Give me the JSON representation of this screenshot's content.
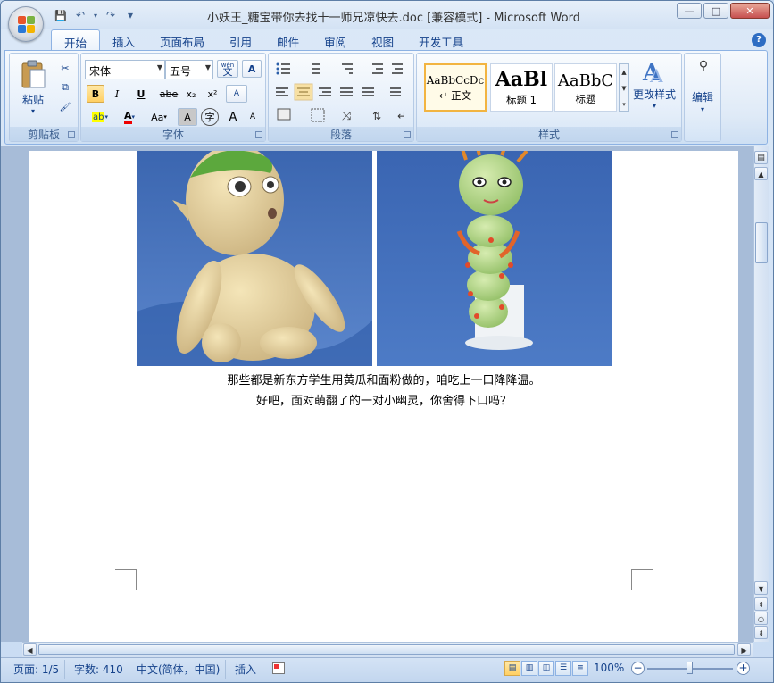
{
  "window": {
    "title": "小妖王_糖宝带你去找十一师兄凉快去.doc [兼容模式] - Microsoft Word",
    "minimize": "—",
    "maximize": "□",
    "close": "✕"
  },
  "quick_access": {
    "save": "💾",
    "undo": "↶",
    "redo": "↷",
    "more": "▾"
  },
  "tabs": [
    "开始",
    "插入",
    "页面布局",
    "引用",
    "邮件",
    "审阅",
    "视图",
    "开发工具"
  ],
  "help": "?",
  "ribbon": {
    "clipboard": {
      "label": "剪贴板",
      "paste": "粘贴",
      "paste_dd": "▾",
      "cut": "✂",
      "copy": "⧉",
      "format_painter": "🖌"
    },
    "font": {
      "label": "字体",
      "font_name": "宋体",
      "font_size": "五号",
      "phonetic": "wén",
      "phonetic_char": "文",
      "border_char": "A",
      "bold": "B",
      "italic": "I",
      "underline": "U",
      "strikethrough": "abe",
      "subscript": "x₂",
      "superscript": "x²",
      "clear": "A",
      "highlight": "ab",
      "font_color": "A",
      "change_case": "Aa",
      "char_shading": "A",
      "enclose": "字",
      "grow": "A",
      "shrink": "A"
    },
    "paragraph": {
      "label": "段落"
    },
    "styles": {
      "label": "样式",
      "items": [
        {
          "sample": "AaBbCcDc",
          "name": "↵ 正文"
        },
        {
          "sample": "AaBl",
          "name": "标题 1"
        },
        {
          "sample": "AaBbC",
          "name": "标题"
        }
      ],
      "change_styles": "更改样式",
      "change_dd": "▾"
    },
    "editing": {
      "label": "编辑",
      "dd": "▾"
    }
  },
  "document": {
    "caption_line1": "那些都是新东方学生用黄瓜和面粉做的，咱吃上一口降降温。",
    "caption_line2": "好吧，面对萌翻了的一对小幽灵，你舍得下口吗？"
  },
  "status": {
    "page": "页面: 1/5",
    "words": "字数: 410",
    "language": "中文(简体，中国)",
    "mode": "插入",
    "zoom": "100%",
    "zoom_out": "−",
    "zoom_in": "+"
  }
}
